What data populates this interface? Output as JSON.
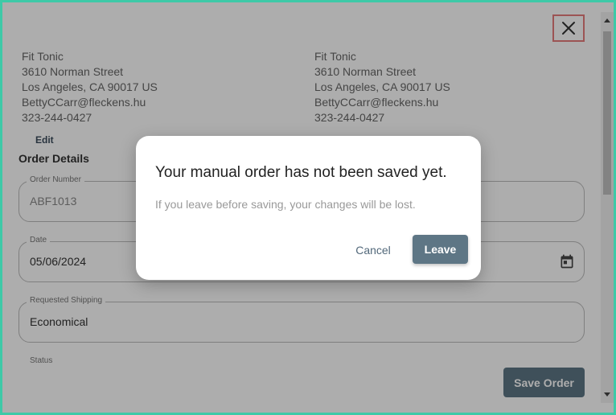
{
  "customer_left": {
    "name": "Fit Tonic",
    "street": "3610 Norman Street",
    "city": "Los Angeles, CA 90017 US",
    "email": "BettyCCarr@fleckens.hu",
    "phone": "323-244-0427"
  },
  "customer_right": {
    "name": "Fit Tonic",
    "street": "3610 Norman Street",
    "city": "Los Angeles, CA 90017 US",
    "email": "BettyCCarr@fleckens.hu",
    "phone": "323-244-0427"
  },
  "edit_label": "Edit",
  "order_details": {
    "title": "Order Details",
    "order_number": {
      "label": "Order Number",
      "value": "ABF1013"
    },
    "date": {
      "label": "Date",
      "value": "05/06/2024"
    },
    "requested_shipping": {
      "label": "Requested Shipping",
      "value": "Economical"
    },
    "status_label": "Status"
  },
  "save_order_label": "Save Order",
  "modal": {
    "title": "Your manual order has not been saved yet.",
    "message": "If you leave before saving, your changes will be lost.",
    "cancel_label": "Cancel",
    "leave_label": "Leave"
  },
  "icons": {
    "close": "close-icon",
    "calendar": "calendar-icon"
  },
  "colors": {
    "primary_button": "#5e7685",
    "close_highlight": "#e67c7c",
    "frame_border": "#3ec9a7"
  }
}
